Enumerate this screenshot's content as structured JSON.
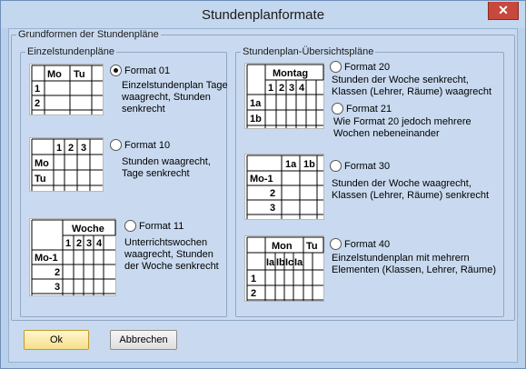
{
  "window": {
    "title": "Stundenplanformate",
    "close_label": "✕"
  },
  "group_main": "Grundformen der Stundenpläne",
  "group_left": "Einzelstundenpläne",
  "group_right": "Stundenplan-Übersichtspläne",
  "formats": {
    "f01": {
      "label": "Format 01",
      "desc1": "Einzelstundenplan Tage",
      "desc2": "waagrecht, Stunden",
      "desc3": "senkrecht",
      "checked": true
    },
    "f10": {
      "label": "Format 10",
      "desc1": "Stunden waagrecht,",
      "desc2": "Tage senkrecht",
      "checked": false
    },
    "f11": {
      "label": "Format 11",
      "desc1": "Unterrichtswochen",
      "desc2": "waagrecht, Stunden",
      "desc3": "der Woche senkrecht",
      "checked": false
    },
    "f20": {
      "label": "Format 20",
      "desc1": "Stunden der Woche senkrecht,",
      "desc2": "Klassen (Lehrer, Räume) waagrecht",
      "checked": false
    },
    "f21": {
      "label": "Format 21",
      "desc1": "Wie Format 20 jedoch mehrere",
      "desc2": "Wochen nebeneinander",
      "checked": false
    },
    "f30": {
      "label": "Format 30",
      "desc1": "Stunden der Woche waagrecht,",
      "desc2": "Klassen (Lehrer, Räume) senkrecht",
      "checked": false
    },
    "f40": {
      "label": "Format 40",
      "desc1": "Einzelstundenplan mit mehrern",
      "desc2": "Elementen (Klassen, Lehrer, Räume)",
      "checked": false
    }
  },
  "previews": {
    "p01": {
      "h1": "Mo",
      "h2": "Tu",
      "r1": "1",
      "r2": "2"
    },
    "p10": {
      "h1": "1",
      "h2": "2",
      "h3": "3",
      "r1": "Mo",
      "r2": "Tu"
    },
    "p11": {
      "top": "Woche",
      "n1": "1",
      "n2": "2",
      "n3": "3",
      "n4": "4",
      "r1": "Mo-1",
      "r2": "2",
      "r3": "3"
    },
    "p20": {
      "top": "Montag",
      "n1": "1",
      "n2": "2",
      "n3": "3",
      "n4": "4",
      "r1": "1a",
      "r2": "1b"
    },
    "p30": {
      "h1": "1a",
      "h2": "1b",
      "r1": "Mo-1",
      "r2": "2",
      "r3": "3"
    },
    "p40": {
      "h1": "Mon",
      "h2": "Tu",
      "s1": "Ia",
      "s2": "Ib",
      "s3": "Ic",
      "s4": "Ia",
      "r1": "1",
      "r2": "2"
    }
  },
  "buttons": {
    "ok": "Ok",
    "cancel": "Abbrechen"
  }
}
